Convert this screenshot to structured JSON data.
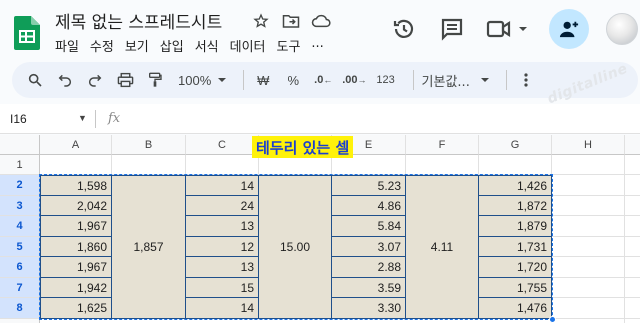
{
  "app": {
    "title": "제목 없는 스프레드시트",
    "menu": [
      "파일",
      "수정",
      "보기",
      "삽입",
      "서식",
      "데이터",
      "도구",
      "..."
    ]
  },
  "toolbar": {
    "zoom": "100%",
    "currency": "₩",
    "percent": "%",
    "dec_decrease": ".0",
    "dec_increase": ".00",
    "number_format": "123",
    "font": "기본값..."
  },
  "formula_bar": {
    "name_box": "I16",
    "fx": "fx"
  },
  "watermark": "digitalline",
  "sheet": {
    "columns": [
      "A",
      "B",
      "C",
      "D",
      "E",
      "F",
      "G",
      "H"
    ],
    "rows": [
      "1",
      "2",
      "3",
      "4",
      "5",
      "6",
      "7",
      "8"
    ],
    "label": "테두리 있는 셀",
    "col_a": [
      "1,598",
      "2,042",
      "1,967",
      "1,860",
      "1,967",
      "1,942",
      "1,625"
    ],
    "col_b_merged": "1,857",
    "col_c": [
      "14",
      "24",
      "13",
      "12",
      "13",
      "15",
      "14"
    ],
    "col_d_merged": "15.00",
    "col_e": [
      "5.23",
      "4.86",
      "5.84",
      "3.07",
      "2.88",
      "3.59",
      "3.30"
    ],
    "col_f_merged": "4.11",
    "col_g": [
      "1,426",
      "1,872",
      "1,879",
      "1,731",
      "1,720",
      "1,755",
      "1,476"
    ]
  },
  "colors": {
    "fill": "#e6e1d3",
    "border": "#1f4f8a",
    "label_bg": "#fff20a",
    "label_text": "#1a3fd0",
    "accent": "#1a73e8"
  }
}
